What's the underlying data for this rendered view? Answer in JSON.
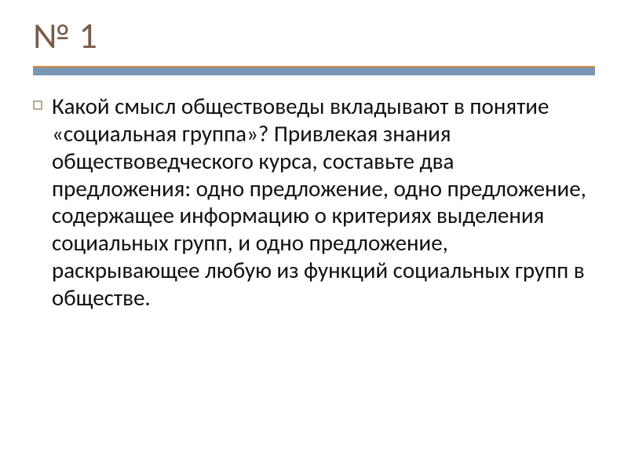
{
  "slide": {
    "title": "№ 1",
    "body": "Какой смысл обществоведы вкладывают в понятие «социальная группа»? Привлекая знания обществоведческого курса, составьте два предложения: одно предложение, одно предложение, содержащее информацию о критериях выделения социальных групп, и одно предложение, раскрывающее любую из функций социальных групп в обществе."
  }
}
